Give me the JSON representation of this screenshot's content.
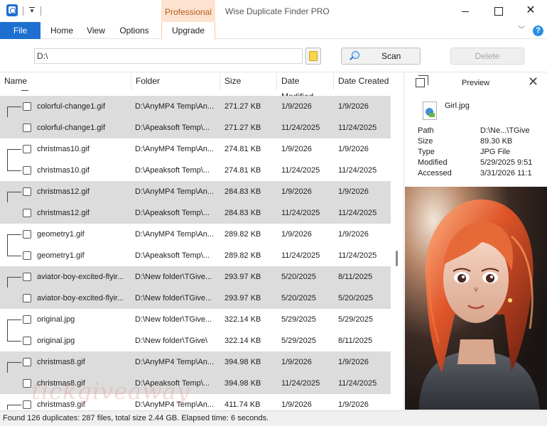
{
  "window": {
    "title": "Wise Duplicate Finder PRO",
    "edition_label": "Professional",
    "minimize_icon": "minimize-icon",
    "maximize_icon": "maximize-icon",
    "close_glyph": "✕"
  },
  "ribbon": {
    "tabs": [
      "File",
      "Home",
      "View",
      "Options",
      "Upgrade"
    ],
    "collapse_glyph": "﹀",
    "help_glyph": "?"
  },
  "toolbar": {
    "path_value": "D:\\",
    "scan_label": "Scan",
    "delete_label": "Delete"
  },
  "table": {
    "columns": [
      "Name",
      "Folder",
      "Size",
      "Date Modified",
      "Date Created"
    ],
    "rows": [
      {
        "name": "colorful-change1.gif",
        "folder": "D:\\AnyMP4 Temp\\An...",
        "size": "271.27 KB",
        "modified": "1/9/2026",
        "created": "1/9/2026"
      },
      {
        "name": "colorful-change1.gif",
        "folder": "D:\\Apeaksoft Temp\\...",
        "size": "271.27 KB",
        "modified": "11/24/2025",
        "created": "11/24/2025"
      },
      {
        "name": "christmas10.gif",
        "folder": "D:\\AnyMP4 Temp\\An...",
        "size": "274.81 KB",
        "modified": "1/9/2026",
        "created": "1/9/2026"
      },
      {
        "name": "christmas10.gif",
        "folder": "D:\\Apeaksoft Temp\\...",
        "size": "274.81 KB",
        "modified": "11/24/2025",
        "created": "11/24/2025"
      },
      {
        "name": "christmas12.gif",
        "folder": "D:\\AnyMP4 Temp\\An...",
        "size": "284.83 KB",
        "modified": "1/9/2026",
        "created": "1/9/2026"
      },
      {
        "name": "christmas12.gif",
        "folder": "D:\\Apeaksoft Temp\\...",
        "size": "284.83 KB",
        "modified": "11/24/2025",
        "created": "11/24/2025"
      },
      {
        "name": "geometry1.gif",
        "folder": "D:\\AnyMP4 Temp\\An...",
        "size": "289.82 KB",
        "modified": "1/9/2026",
        "created": "1/9/2026"
      },
      {
        "name": "geometry1.gif",
        "folder": "D:\\Apeaksoft Temp\\...",
        "size": "289.82 KB",
        "modified": "11/24/2025",
        "created": "11/24/2025"
      },
      {
        "name": "aviator-boy-excited-flyir...",
        "folder": "D:\\New folder\\TGive...",
        "size": "293.97 KB",
        "modified": "5/20/2025",
        "created": "8/11/2025"
      },
      {
        "name": "aviator-boy-excited-flyir...",
        "folder": "D:\\New folder\\TGive...",
        "size": "293.97 KB",
        "modified": "5/20/2025",
        "created": "5/20/2025"
      },
      {
        "name": "original.jpg",
        "folder": "D:\\New folder\\TGive...",
        "size": "322.14 KB",
        "modified": "5/29/2025",
        "created": "5/29/2025"
      },
      {
        "name": "original.jpg",
        "folder": "D:\\New folder\\TGive\\",
        "size": "322.14 KB",
        "modified": "5/29/2025",
        "created": "8/11/2025"
      },
      {
        "name": "christmas8.gif",
        "folder": "D:\\AnyMP4 Temp\\An...",
        "size": "394.98 KB",
        "modified": "1/9/2026",
        "created": "1/9/2026"
      },
      {
        "name": "christmas8.gif",
        "folder": "D:\\Apeaksoft Temp\\...",
        "size": "394.98 KB",
        "modified": "11/24/2025",
        "created": "11/24/2025"
      },
      {
        "name": "christmas9.gif",
        "folder": "D:\\AnyMP4 Temp\\An...",
        "size": "411.74 KB",
        "modified": "1/9/2026",
        "created": "1/9/2026"
      }
    ]
  },
  "preview": {
    "title": "Preview",
    "close_glyph": "✕",
    "filename": "Girl.jpg",
    "meta": [
      {
        "key": "Path",
        "value": "D:\\Ne...\\TGive"
      },
      {
        "key": "Size",
        "value": "89.30 KB"
      },
      {
        "key": "Type",
        "value": "JPG File"
      },
      {
        "key": "Modified",
        "value": "5/29/2025 9:51"
      },
      {
        "key": "Accessed",
        "value": "3/31/2026 11:1"
      }
    ]
  },
  "status": {
    "text": "Found 126 duplicates: 287 files, total size 2.44 GB. Elapsed time: 6 seconds."
  },
  "watermark": {
    "text": "tickgiveaway"
  },
  "colors": {
    "accent": "#1e6fd0",
    "professional_bg": "#fde3cf",
    "professional_text": "#b25e1f",
    "group_gray": "#dcdcdc"
  }
}
